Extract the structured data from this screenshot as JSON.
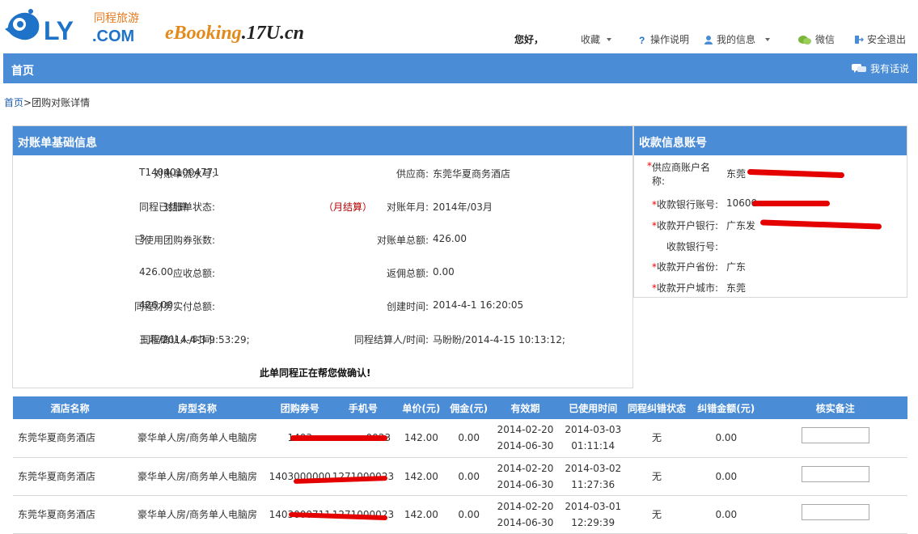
{
  "header": {
    "logo": {
      "brand": "LY",
      "brand_suffix": ".COM",
      "brand_cn": "同程旅游"
    },
    "ebooking": {
      "main": "eBooking",
      "domain": ".17U.cn"
    },
    "greeting": "您好，",
    "nav": [
      {
        "label": "收藏",
        "icon": "chevron-down-icon"
      },
      {
        "label": "操作说明",
        "icon": "help-icon"
      },
      {
        "label": "我的信息",
        "icon": "user-icon"
      },
      {
        "label": "微信",
        "icon": "wechat-icon"
      },
      {
        "label": "安全退出",
        "icon": "logout-icon"
      }
    ]
  },
  "bluebar": {
    "title": "首页",
    "feedback": "我有话说"
  },
  "breadcrumb": {
    "home": "首页",
    "sep": ">",
    "current": "团购对账详情"
  },
  "basic": {
    "title": "对账单基础信息",
    "fields": [
      {
        "label": "对账单流水号:",
        "value": "T140401004771"
      },
      {
        "label": "供应商:",
        "value": "东莞华夏商务酒店"
      },
      {
        "label": "对账单状态:",
        "value": "同程已结算"
      },
      {
        "label": "对账年月:",
        "value": "2014年/03月",
        "tag": "（月结算）"
      },
      {
        "label": "已使用团购券张数:",
        "value": "3"
      },
      {
        "label": "对账单总额:",
        "value": "426.00"
      },
      {
        "label": "应收总额:",
        "value": "426.00"
      },
      {
        "label": "返佣总额:",
        "value": "0.00"
      },
      {
        "label": "同程财务实付总额:",
        "value": "426.00"
      },
      {
        "label": "创建时间:",
        "value": "2014-4-1 16:20:05"
      },
      {
        "label": "同程确认人/时间:",
        "value": "王菲/2014-4-3 9:53:29;"
      },
      {
        "label": "同程结算人/时间:",
        "value": "马盼盼/2014-4-15 10:13:12;"
      }
    ],
    "notice": "此单同程正在帮您做确认!"
  },
  "account": {
    "title": "收款信息账号",
    "fields": [
      {
        "label": "供应商账户名称:",
        "value": "东莞",
        "required": "*"
      },
      {
        "label": "收款银行账号:",
        "value": "10600",
        "required": "*"
      },
      {
        "label": "收款开户银行:",
        "value": "广东发",
        "required": "*"
      },
      {
        "label": "收款银行号:",
        "value": "",
        "required": ""
      },
      {
        "label": "收款开户省份:",
        "value": "广东",
        "required": "*"
      },
      {
        "label": "收款开户城市:",
        "value": "东莞",
        "required": "*"
      }
    ]
  },
  "table": {
    "headers": [
      "酒店名称",
      "房型名称",
      "团购券号",
      "手机号",
      "单价(元)",
      "佣金(元)",
      "有效期",
      "已使用时间",
      "同程纠错状态",
      "纠错金额(元)",
      "核实备注"
    ],
    "rows": [
      {
        "hotel": "东莞华夏商务酒店",
        "room": "豪华单人房/商务单人电脑房",
        "code": "1403",
        "phone": "0023",
        "price": "142.00",
        "commission": "0.00",
        "valid_from": "2014-02-20",
        "valid_to": "2014-06-30",
        "used_date": "2014-03-03",
        "used_time": "01:11:14",
        "status": "无",
        "amount": "0.00"
      },
      {
        "hotel": "东莞华夏商务酒店",
        "room": "豪华单人房/商务单人电脑房",
        "code": "1403000000",
        "phone": "1271000023",
        "price": "142.00",
        "commission": "0.00",
        "valid_from": "2014-02-20",
        "valid_to": "2014-06-30",
        "used_date": "2014-03-02",
        "used_time": "11:27:36",
        "status": "无",
        "amount": "0.00"
      },
      {
        "hotel": "东莞华夏商务酒店",
        "room": "豪华单人房/商务单人电脑房",
        "code": "1403000711",
        "phone": "1271000023",
        "price": "142.00",
        "commission": "0.00",
        "valid_from": "2014-02-20",
        "valid_to": "2014-06-30",
        "used_date": "2014-03-01",
        "used_time": "12:29:39",
        "status": "无",
        "amount": "0.00"
      }
    ]
  }
}
